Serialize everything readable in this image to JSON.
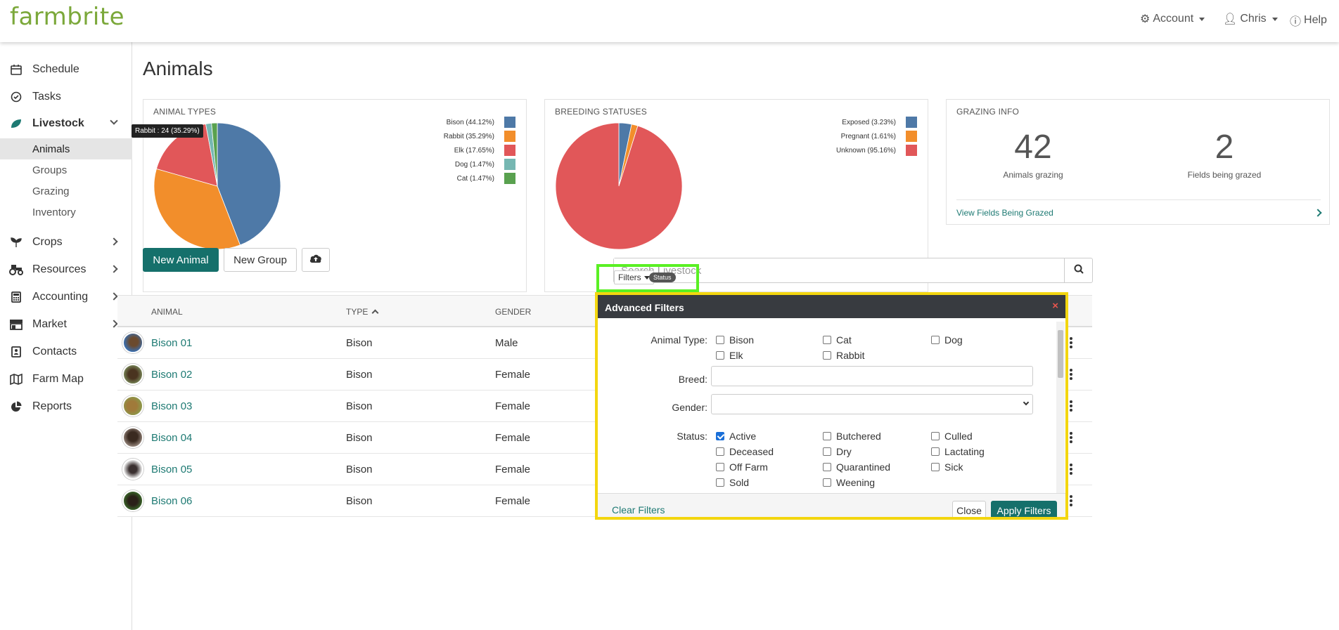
{
  "app": {
    "logo": "farmbrite"
  },
  "topnav": {
    "account": "Account",
    "user": "Chris",
    "help": "Help"
  },
  "sidebar": {
    "items": [
      {
        "label": "Schedule"
      },
      {
        "label": "Tasks"
      },
      {
        "label": "Livestock"
      },
      {
        "label": "Crops"
      },
      {
        "label": "Resources"
      },
      {
        "label": "Accounting"
      },
      {
        "label": "Market"
      },
      {
        "label": "Contacts"
      },
      {
        "label": "Farm Map"
      },
      {
        "label": "Reports"
      }
    ],
    "livestock_sub": [
      {
        "label": "Animals",
        "active": true
      },
      {
        "label": "Groups"
      },
      {
        "label": "Grazing"
      },
      {
        "label": "Inventory"
      }
    ]
  },
  "page": {
    "title": "Animals"
  },
  "cards": {
    "animal_types": {
      "title": "ANIMAL TYPES",
      "tooltip": "Rabbit : 24 (35.29%)",
      "legend": [
        {
          "label": "Bison (44.12%)",
          "color": "#4e79a7"
        },
        {
          "label": "Rabbit (35.29%)",
          "color": "#f28e2b"
        },
        {
          "label": "Elk (17.65%)",
          "color": "#e15759"
        },
        {
          "label": "Dog (1.47%)",
          "color": "#76b7b2"
        },
        {
          "label": "Cat (1.47%)",
          "color": "#59a14f"
        }
      ]
    },
    "breeding_statuses": {
      "title": "BREEDING STATUSES",
      "legend": [
        {
          "label": "Exposed (3.23%)",
          "color": "#4e79a7"
        },
        {
          "label": "Pregnant (1.61%)",
          "color": "#f28e2b"
        },
        {
          "label": "Unknown (95.16%)",
          "color": "#e15759"
        }
      ]
    },
    "grazing": {
      "title": "GRAZING INFO",
      "animals_count": "42",
      "animals_label": "Animals grazing",
      "fields_count": "2",
      "fields_label": "Fields being grazed",
      "link": "View Fields Being Grazed"
    }
  },
  "chart_data": [
    {
      "type": "pie",
      "title": "ANIMAL TYPES",
      "categories": [
        "Bison",
        "Rabbit",
        "Elk",
        "Dog",
        "Cat"
      ],
      "values": [
        44.12,
        35.29,
        17.65,
        1.47,
        1.47
      ],
      "colors": [
        "#4e79a7",
        "#f28e2b",
        "#e15759",
        "#76b7b2",
        "#59a14f"
      ]
    },
    {
      "type": "pie",
      "title": "BREEDING STATUSES",
      "categories": [
        "Exposed",
        "Pregnant",
        "Unknown"
      ],
      "values": [
        3.23,
        1.61,
        95.16
      ],
      "colors": [
        "#4e79a7",
        "#f28e2b",
        "#e15759"
      ]
    }
  ],
  "toolbar": {
    "new_animal": "New Animal",
    "new_group": "New Group"
  },
  "search": {
    "placeholder": "Search Livestock"
  },
  "filters": {
    "button": "Filters",
    "pill": "Status"
  },
  "table": {
    "headers": {
      "animal": "ANIMAL",
      "type": "TYPE",
      "gender": "GENDER"
    },
    "rows": [
      {
        "name": "Bison 01",
        "type": "Bison",
        "gender": "Male"
      },
      {
        "name": "Bison 02",
        "type": "Bison",
        "gender": "Female"
      },
      {
        "name": "Bison 03",
        "type": "Bison",
        "gender": "Female"
      },
      {
        "name": "Bison 04",
        "type": "Bison",
        "gender": "Female"
      },
      {
        "name": "Bison 05",
        "type": "Bison",
        "gender": "Female"
      },
      {
        "name": "Bison 06",
        "type": "Bison",
        "gender": "Female"
      }
    ]
  },
  "advanced_filters": {
    "title": "Advanced Filters",
    "close_x": "×",
    "animal_type_label": "Animal Type:",
    "animal_types": [
      {
        "label": "Bison",
        "checked": false
      },
      {
        "label": "Cat",
        "checked": false
      },
      {
        "label": "Dog",
        "checked": false
      },
      {
        "label": "Elk",
        "checked": false
      },
      {
        "label": "Rabbit",
        "checked": false
      }
    ],
    "breed_label": "Breed:",
    "breed_value": "",
    "gender_label": "Gender:",
    "gender_value": "",
    "status_label": "Status:",
    "statuses": [
      {
        "label": "Active",
        "checked": true
      },
      {
        "label": "Butchered",
        "checked": false
      },
      {
        "label": "Culled",
        "checked": false
      },
      {
        "label": "Deceased",
        "checked": false
      },
      {
        "label": "Dry",
        "checked": false
      },
      {
        "label": "Lactating",
        "checked": false
      },
      {
        "label": "Off Farm",
        "checked": false
      },
      {
        "label": "Quarantined",
        "checked": false
      },
      {
        "label": "Sick",
        "checked": false
      },
      {
        "label": "Sold",
        "checked": false
      },
      {
        "label": "Weening",
        "checked": false
      }
    ],
    "clear": "Clear Filters",
    "close": "Close",
    "apply": "Apply Filters"
  }
}
